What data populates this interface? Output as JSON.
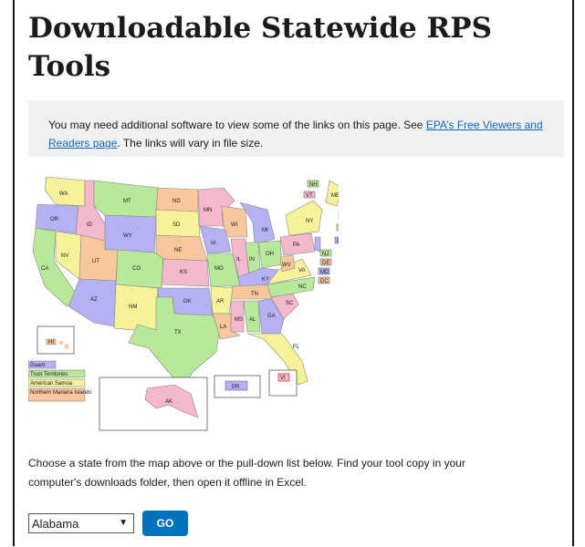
{
  "page": {
    "title": "Downloadable Statewide RPS Tools"
  },
  "notice": {
    "text_before": "You may need additional software to view some of the links on this page. See ",
    "link_text": "EPA’s Free Viewers and Readers page",
    "text_after": ". The links will vary in file size."
  },
  "map": {
    "state_labels": [
      "WA",
      "MT",
      "ND",
      "OR",
      "ID",
      "SD",
      "MN",
      "WI",
      "MI",
      "NY",
      "WY",
      "NE",
      "IA",
      "NV",
      "UT",
      "CO",
      "KS",
      "MO",
      "IL",
      "IN",
      "OH",
      "PA",
      "CA",
      "KY",
      "WV",
      "VA",
      "AZ",
      "NM",
      "OK",
      "AR",
      "TN",
      "NC",
      "SC",
      "TX",
      "LA",
      "MS",
      "AL",
      "GA",
      "FL",
      "ME",
      "NH",
      "VT",
      "MA",
      "RI",
      "CT",
      "NJ",
      "DE",
      "MD",
      "DC",
      "HI",
      "AK",
      "PR",
      "VI"
    ],
    "territory_legend": [
      "Guam",
      "Trust Territories",
      "American Samoa",
      "Northern Mariana Islands"
    ]
  },
  "instructions": {
    "line1": "Choose a state from the map above or the pull-down list below.  Find your tool copy in your",
    "line2": "computer's downloads folder, then open it offline in Excel."
  },
  "controls": {
    "state_selected": "Alabama",
    "go_label": "GO"
  }
}
